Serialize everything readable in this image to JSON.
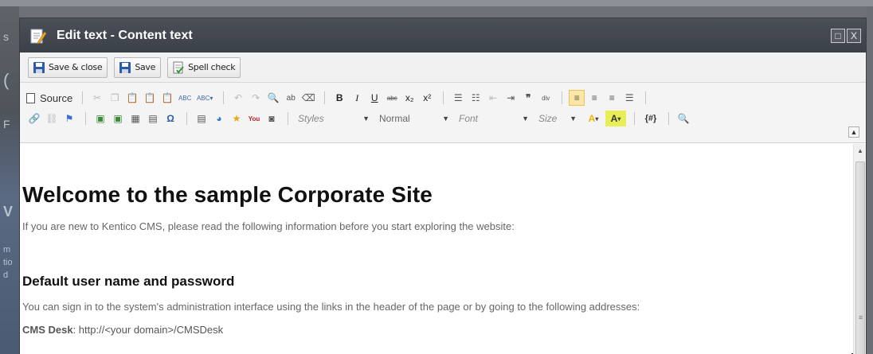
{
  "background": {
    "fragments": [
      "s",
      "(",
      "F",
      "V",
      "m",
      "tio",
      "d"
    ]
  },
  "dialog": {
    "title": "Edit text - Content text",
    "title_icon": "edit-document-icon",
    "controls": {
      "maximize": "□",
      "close": "X"
    }
  },
  "actions": {
    "save_close_label": "Save & close",
    "save_label": "Save",
    "spell_check_label": "Spell check"
  },
  "toolbar": {
    "source_label": "Source",
    "styles_label": "Styles",
    "format_label": "Normal",
    "font_label": "Font",
    "size_label": "Size",
    "placeholder_label": "{#}",
    "row1_icons": [
      "cut-icon",
      "copy-icon",
      "paste-icon",
      "paste-text-icon",
      "paste-word-icon",
      "spellcheck-icon",
      "spellcheck-as-you-type-icon",
      "undo-icon",
      "redo-icon",
      "find-icon",
      "replace-icon",
      "remove-format-icon"
    ],
    "format_icons": [
      "bold-icon",
      "italic-icon",
      "underline-icon",
      "strike-icon",
      "subscript-icon",
      "superscript-icon"
    ],
    "list_icons": [
      "numbered-list-icon",
      "bulleted-list-icon",
      "outdent-icon",
      "indent-icon",
      "blockquote-icon",
      "div-icon"
    ],
    "align_icons": [
      "align-left-icon",
      "align-center-icon",
      "align-right-icon",
      "justify-icon"
    ],
    "row2_icons": [
      "link-icon",
      "unlink-icon",
      "anchor-icon",
      "image-icon",
      "insert-image-icon",
      "table-icon",
      "horizontal-rule-icon",
      "special-char-icon",
      "form-icon",
      "flash-icon",
      "widget-icon",
      "youtube-icon",
      "media-icon"
    ],
    "text_color": "A",
    "bg_color": "A"
  },
  "content": {
    "heading": "Welcome to the sample Corporate Site",
    "intro": "If you are new to Kentico CMS, please read the following information before you start exploring the website:",
    "subheading": "Default user name and password",
    "sign_in_text": "You can sign in to the system's administration interface using the links in the header of the page or by going to the following addresses:",
    "cms_desk_label": "CMS Desk",
    "cms_desk_value": ": http://<your domain>/CMSDesk"
  },
  "colors": {
    "titlebar": "#3b4049",
    "active_align": "#fbe6a6",
    "text_color_swatch": "#f2b600",
    "bg_color_swatch": "#d8e000"
  }
}
